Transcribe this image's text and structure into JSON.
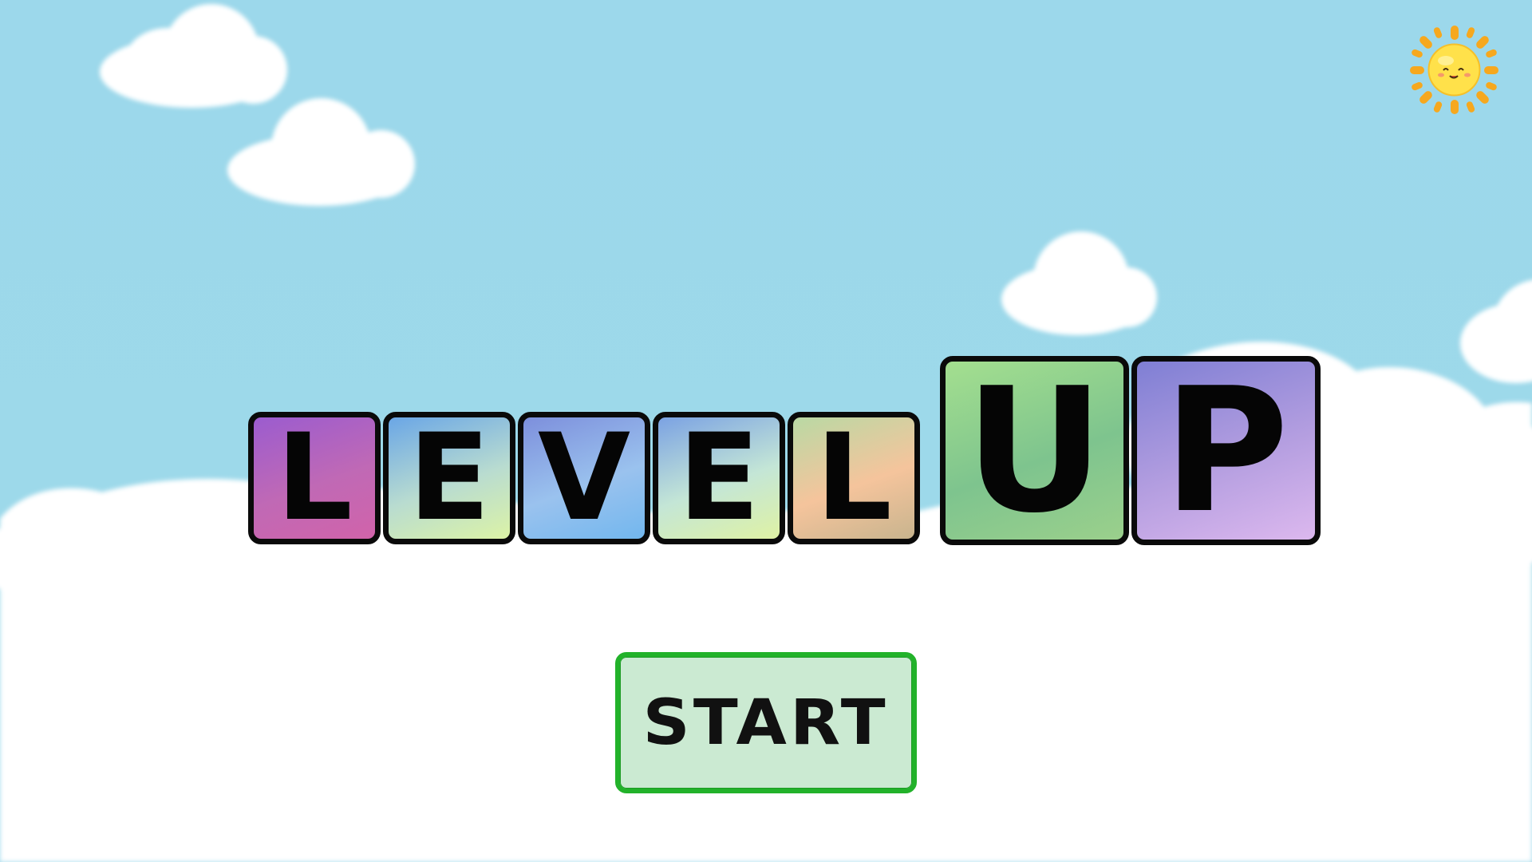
{
  "game": {
    "title_letters": [
      {
        "char": "L",
        "size": "small",
        "gradient": [
          "#9b5ccf",
          "#c069b5",
          "#d163aa"
        ]
      },
      {
        "char": "E",
        "size": "small",
        "gradient": [
          "#6aa6e6",
          "#b9dcd0",
          "#dcf3a6"
        ]
      },
      {
        "char": "V",
        "size": "small",
        "gradient": [
          "#7d8fdc",
          "#9ac2ee",
          "#72b7ee"
        ]
      },
      {
        "char": "E",
        "size": "small",
        "gradient": [
          "#7ba2e3",
          "#c4e6d6",
          "#dff2a4"
        ]
      },
      {
        "char": "L",
        "size": "small",
        "gradient": [
          "#b9d9a4",
          "#f5c49c",
          "#c8b48e"
        ]
      },
      {
        "char": "U",
        "size": "big",
        "gradient": [
          "#a4df8f",
          "#7ec48e",
          "#9bd08c"
        ]
      },
      {
        "char": "P",
        "size": "big",
        "gradient": [
          "#7f7fd4",
          "#b49ee0",
          "#dcb8ee"
        ]
      }
    ],
    "start_label": "START"
  },
  "icons": {
    "sun": "sun-icon"
  },
  "colors": {
    "sky": "#9dd9ea",
    "cloud": "#ffffff",
    "start_fill": "#cbead2",
    "start_border": "#22b22a",
    "sun": "#ffe14a",
    "sun_rays": "#f6a81e"
  }
}
